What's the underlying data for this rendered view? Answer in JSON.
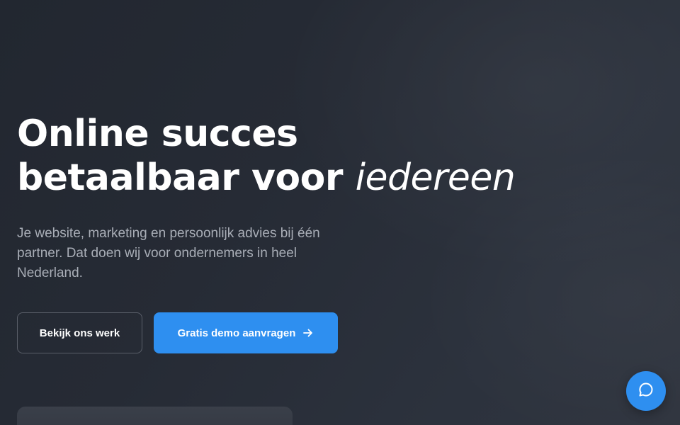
{
  "hero": {
    "headline_line1": "Online succes",
    "headline_line2": "betaalbaar voor",
    "headline_accent": "iedereen",
    "subtitle": "Je website, marketing en persoonlijk advies bij één partner. Dat doen wij voor ondernemers in heel Nederland."
  },
  "actions": {
    "secondary_label": "Bekijk ons werk",
    "primary_label": "Gratis demo aanvragen",
    "primary_icon": "arrow-right-icon"
  },
  "chat": {
    "icon": "chat-bubble-icon"
  },
  "colors": {
    "accent": "#2e8ff0",
    "background": "#262b35",
    "subtitle_text": "#a9aeb7"
  }
}
